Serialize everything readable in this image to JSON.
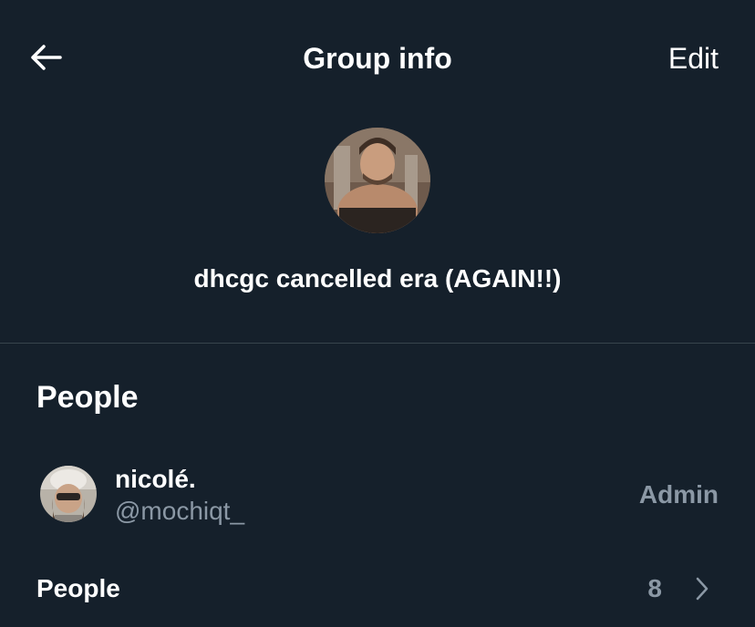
{
  "header": {
    "title": "Group info",
    "edit_label": "Edit"
  },
  "group": {
    "name": "dhcgc cancelled era (AGAIN!!)"
  },
  "people_section": {
    "title": "People",
    "members": [
      {
        "name": "nicolé.",
        "handle": "@mochiqt_",
        "role": "Admin"
      }
    ],
    "summary": {
      "label": "People",
      "count": "8"
    }
  },
  "icons": {
    "back": "arrow-left-icon",
    "chevron": "chevron-right-icon"
  },
  "colors": {
    "background": "#15202b",
    "text_primary": "#ffffff",
    "text_secondary": "#8b98a5",
    "divider": "#38444d"
  }
}
